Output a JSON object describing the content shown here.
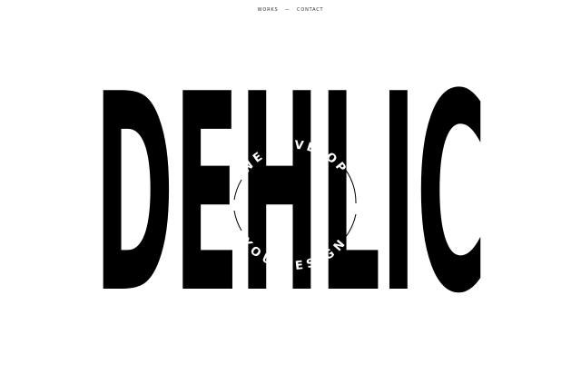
{
  "nav": {
    "works_label": "WORKS",
    "separator": "—",
    "contact_label": "CONTACT"
  },
  "logo": {
    "text": "DEHLIC",
    "color": "#000000"
  },
  "badge": {
    "text_top": "WE DEVELOP",
    "text_bottom": "YOU DESIGN",
    "text_color": "#ffffff",
    "line_color": "#000000"
  }
}
